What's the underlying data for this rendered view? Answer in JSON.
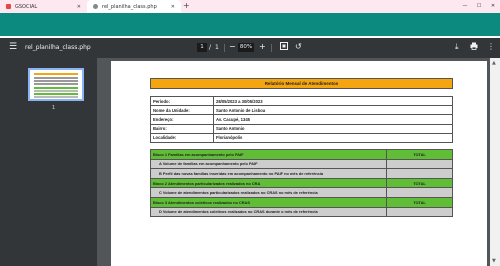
{
  "browser": {
    "tabs": [
      {
        "label": "GSOCIAL",
        "active": false
      },
      {
        "label": "rel_planilha_class.php",
        "active": true
      }
    ],
    "new_tab_icon": "plus-icon",
    "colors": {
      "tabstrip": "#fde8ef",
      "toolbar": "#0d8a7f"
    }
  },
  "viewer": {
    "menu_icon": "hamburger-menu-icon",
    "filename": "rel_planilha_class.php",
    "current_page": "1",
    "page_separator": "/",
    "total_pages": "1",
    "zoom": "80%",
    "zoom_out": "−",
    "zoom_in": "+",
    "thumbnail_label": "1",
    "icons": [
      "fit-page-icon",
      "rotate-icon",
      "download-icon",
      "print-icon",
      "more-icon"
    ]
  },
  "report": {
    "title": "Relatório Mensal de Atendimentos",
    "title_color": "#f5a510",
    "info": [
      {
        "label": "Período:",
        "value": "28/05/2023 a 30/05/2023"
      },
      {
        "label": "Nome da Unidade:",
        "value": "Santo Antonio de Lisboa"
      },
      {
        "label": "Endereço:",
        "value": "Av. Cacupé, 1345"
      },
      {
        "label": "Bairro:",
        "value": "Santo Antonio"
      },
      {
        "label": "Localidade:",
        "value": "Florianópolis"
      }
    ],
    "blocks": [
      {
        "type": "header",
        "desc": "Bloco 1 Famílias em acompanhamento pelo PAIF",
        "total": "TOTAL"
      },
      {
        "type": "item",
        "desc": "A Volume de famílias em acompanhamento pelo PAIF",
        "total": ""
      },
      {
        "type": "item",
        "desc": "B Perfil das novas famílias inseridas em acompanhamento no PAIF no mês de referência",
        "total": ""
      },
      {
        "type": "header",
        "desc": "Bloco 2 Atendimentos particularizados realizados no CRA",
        "total": "TOTAL"
      },
      {
        "type": "item",
        "desc": "C Volume de atendimentos particularizados realizados no CRAS no mês de referência",
        "total": ""
      },
      {
        "type": "header",
        "desc": "Bloco 3 Atendimentos coletivos realizados no CRAS",
        "total": "TOTAL"
      },
      {
        "type": "item",
        "desc": "D Volume de atendimentos coletivos realizados no CRAS durante o mês de referência",
        "total": ""
      }
    ],
    "colors": {
      "block_header": "#5fbd36",
      "block_item": "#cdcdcd"
    }
  }
}
